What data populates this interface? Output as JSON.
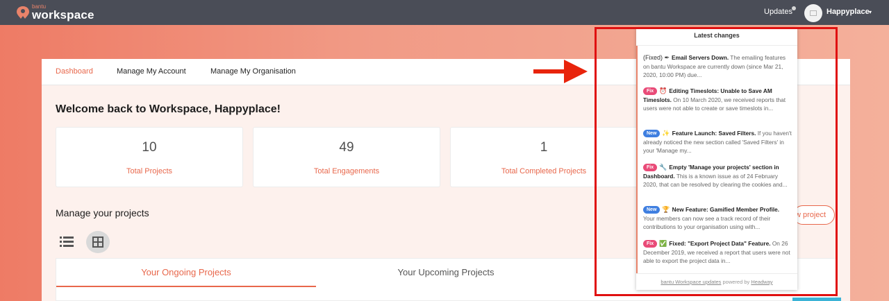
{
  "brand": {
    "small": "bantu",
    "big": "workspace"
  },
  "topbar": {
    "updates_label": "Updates",
    "username": "Happyplace",
    "caret": "▾"
  },
  "nav": {
    "items": [
      "Dashboard",
      "Manage My Account",
      "Manage My Organisation"
    ]
  },
  "welcome": "Welcome back to Workspace, Happyplace!",
  "stats": [
    {
      "value": "10",
      "label": "Total Projects"
    },
    {
      "value": "49",
      "label": "Total Engagements"
    },
    {
      "value": "1",
      "label": "Total Completed Projects"
    }
  ],
  "projects": {
    "title": "Manage your projects",
    "new_button": "w project",
    "tabs": [
      "Your Ongoing Projects",
      "Your Upcoming Projects"
    ]
  },
  "popup": {
    "title": "Latest changes",
    "entries": [
      {
        "badge": "",
        "emoji": "(Fixed) ✒",
        "title": "Email Servers Down.",
        "text": "The emailing features on bantu Workspace are currently down (since Mar 21, 2020, 10:00 PM) due..."
      },
      {
        "badge": "Fix",
        "emoji": "⏰",
        "title": "Editing Timeslots: Unable to Save AM Timeslots.",
        "text": "On 10 March 2020, we received reports that users were not able to create or save timeslots in..."
      },
      {
        "badge": "New",
        "emoji": "✨",
        "title": "Feature Launch: Saved Filters.",
        "text": "If you haven't already noticed the new section called 'Saved Filters' in your 'Manage my..."
      },
      {
        "badge": "Fix",
        "emoji": "🔧",
        "title": "Empty 'Manage your projects' section in Dashboard.",
        "text": "This is a known issue as of 24 February 2020, that can be resolved by clearing the cookies and..."
      },
      {
        "badge": "New",
        "emoji": "🏆",
        "title": "New Feature: Gamified Member Profile.",
        "text": "Your members can now see a track record of their contributions to your organisation using with..."
      },
      {
        "badge": "Fix",
        "emoji": "✅",
        "title": "Fixed: \"Export Project Data\" Feature.",
        "text": "On 26 December 2019, we received a report that users were not able to export the project data in..."
      }
    ],
    "footer_link": "bantu Workspace updates",
    "footer_mid": " powered by ",
    "footer_brand": "Headway"
  },
  "colors": {
    "accent": "#e8674b",
    "topbar": "#4a4d57",
    "highlight": "#e01010"
  }
}
